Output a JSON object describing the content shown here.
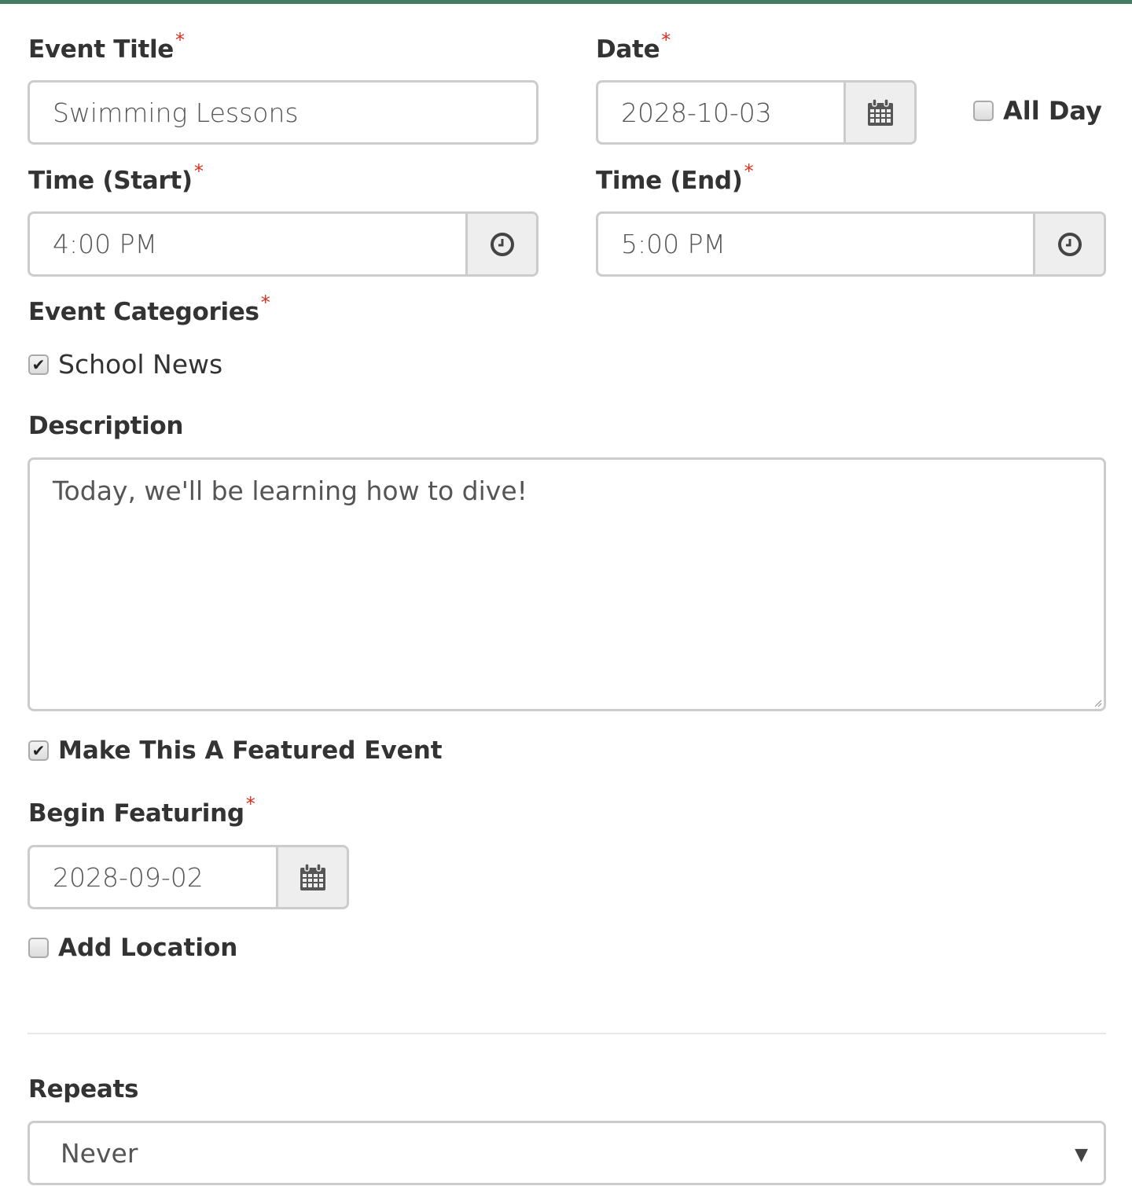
{
  "colors": {
    "accent_bar": "#457a62",
    "required_asterisk": "#d9301f",
    "label_text": "#333333",
    "input_text": "#555555",
    "border": "#cccccc",
    "addon_bg": "#eeeeee"
  },
  "form": {
    "event_title": {
      "label": "Event Title",
      "required": "*",
      "value": "Swimming Lessons"
    },
    "date": {
      "label": "Date",
      "required": "*",
      "value": "2028-10-03",
      "icon": "calendar-icon"
    },
    "all_day": {
      "label": "All Day",
      "checked": false
    },
    "time_start": {
      "label": "Time (Start)",
      "required": "*",
      "value": "4:00 PM",
      "icon": "clock-icon"
    },
    "time_end": {
      "label": "Time (End)",
      "required": "*",
      "value": "5:00 PM",
      "icon": "clock-icon"
    },
    "event_categories": {
      "label": "Event Categories",
      "required": "*",
      "options": [
        {
          "label": "School News",
          "checked": true,
          "mark": "✔"
        }
      ]
    },
    "description": {
      "label": "Description",
      "value": "Today, we'll be learning how to dive!"
    },
    "featured": {
      "label": "Make This A Featured Event",
      "checked": true,
      "mark": "✔"
    },
    "begin_featuring": {
      "label": "Begin Featuring",
      "required": "*",
      "value": "2028-09-02",
      "icon": "calendar-icon"
    },
    "add_location": {
      "label": "Add Location",
      "checked": false
    },
    "repeats": {
      "label": "Repeats",
      "value": "Never",
      "arrow": "▼"
    }
  }
}
